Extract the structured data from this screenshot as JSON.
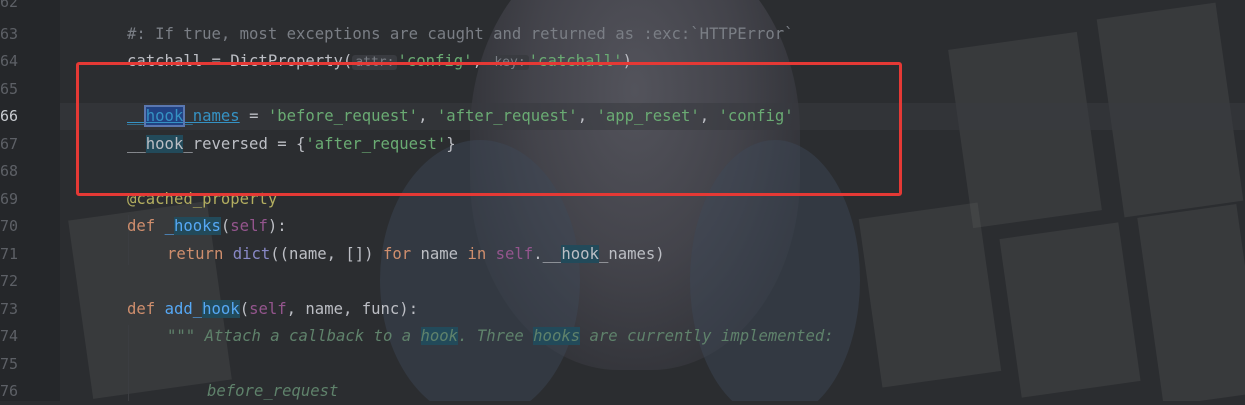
{
  "editor": {
    "line_numbers": [
      "62",
      "63",
      "64",
      "65",
      "66",
      "67",
      "68",
      "69",
      "70",
      "71",
      "72",
      "73",
      "74",
      "75",
      "76"
    ],
    "active_line": "66",
    "lines": {
      "l62": "",
      "l63_comment": "#: If true, most exceptions are caught and returned as :exc:`HTTPError`",
      "l64_name": "catchall = DictProperty(",
      "l64_hint_attr": "attr:",
      "l64_attr": "'config'",
      "l64_comma": ", ",
      "l64_hint_key": "key:",
      "l64_key": "'catchall'",
      "l64_close": ")",
      "l66_var_prefix": "__",
      "l66_var_hook": "hook",
      "l66_var_suffix": "_names",
      "l66_eq": " = ",
      "l66_s1": "'before_request'",
      "l66_s2": "'after_request'",
      "l66_s3": "'app_reset'",
      "l66_s4": "'config'",
      "l66_sep": ", ",
      "l67_prefix": "__",
      "l67_hook": "hook",
      "l67_suffix": "_reversed = {",
      "l67_str": "'after_request'",
      "l67_close": "}",
      "l69_decorator": "@cached_property",
      "l70_def": "def ",
      "l70_us": "_",
      "l70_hook": "hooks",
      "l70_open": "(",
      "l70_self": "self",
      "l70_close": "):",
      "l71_return": "return ",
      "l71_dict": "dict",
      "l71_mid": "((name, []) ",
      "l71_for": "for",
      "l71_name": " name ",
      "l71_in": "in",
      "l71_sp": " ",
      "l71_self": "self",
      "l71_dot": ".__",
      "l71_hook": "hook",
      "l71_end": "_names)",
      "l73_def": "def ",
      "l73_add": "add_",
      "l73_hook": "hook",
      "l73_open": "(",
      "l73_self": "self",
      "l73_rest": ", name, func):",
      "l74_quotes": "\"\"\" ",
      "l74_t1": "Attach a callback to a ",
      "l74_hook": "hook",
      "l74_t2": ". Three ",
      "l74_hooks": "hooks",
      "l74_t3": " are currently implemented:",
      "l76": "before_request"
    }
  },
  "colors": {
    "annotation_box": "#e53935",
    "string": "#6aab73",
    "keyword": "#cf8e6d",
    "function": "#56a8f5",
    "comment": "#7a7e85",
    "docstring": "#5f826b"
  }
}
